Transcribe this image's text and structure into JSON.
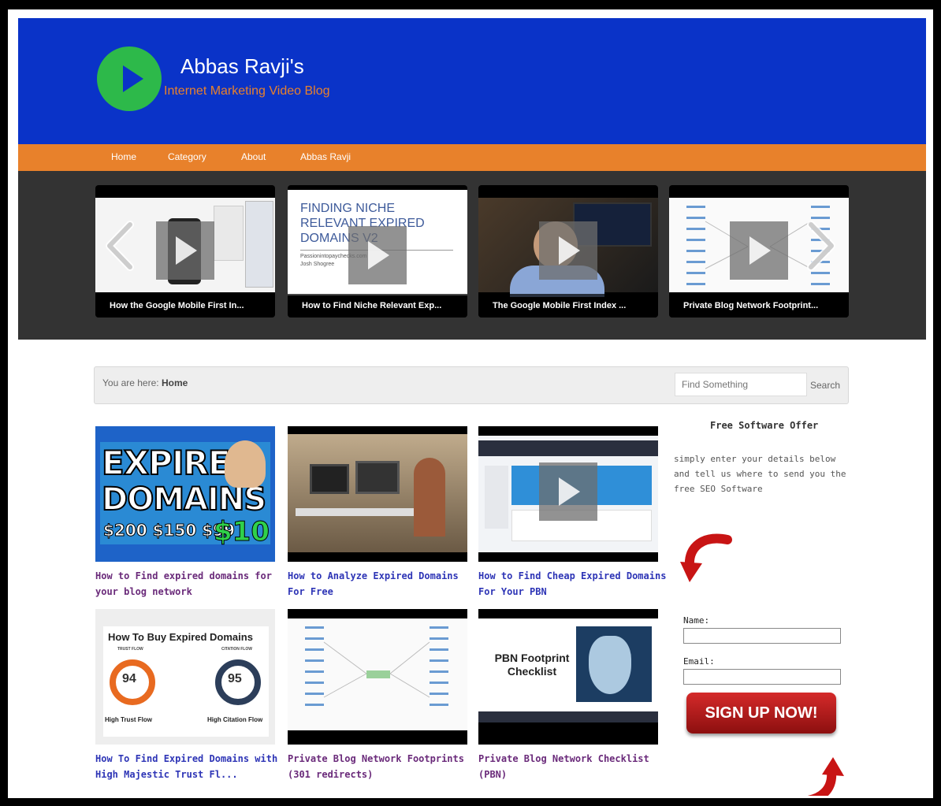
{
  "site": {
    "title": "Abbas Ravji's",
    "tagline": "Internet Marketing Video Blog"
  },
  "nav": {
    "items": [
      {
        "label": "Home"
      },
      {
        "label": "Category"
      },
      {
        "label": "About"
      },
      {
        "label": "Abbas Ravji"
      }
    ]
  },
  "slider": {
    "slides": [
      {
        "caption": "How the Google Mobile First In..."
      },
      {
        "caption": "How to Find Niche Relevant Exp...",
        "slide_text": [
          "FINDING NICHE",
          "RELEVANT EXPIRED",
          "DOMAINS V2"
        ],
        "sub_text": [
          "Passionintopaychecks.com",
          "Josh Shogree"
        ]
      },
      {
        "caption": "The Google Mobile First Index ..."
      },
      {
        "caption": "Private Blog Network Footprint..."
      }
    ]
  },
  "breadcrumb": {
    "prefix": "You are here:",
    "current": "Home"
  },
  "search": {
    "placeholder": "Find Something",
    "button": "Search"
  },
  "posts": [
    {
      "title": "How to Find expired domains for your blog network",
      "thumb_text": [
        "EXPIRED",
        "DOMAINS",
        "$200 $150 $99",
        "$10"
      ]
    },
    {
      "title": "How to Analyze Expired Domains For Free"
    },
    {
      "title": "How to Find Cheap Expired Domains For Your PBN"
    },
    {
      "title": "How To Find Expired Domains with High Majestic Trust Fl...",
      "thumb_text": [
        "How To Buy Expired Domains",
        "TRUST FLOW",
        "CITATION FLOW",
        "94",
        "95",
        "High Trust Flow",
        "High Citation Flow"
      ]
    },
    {
      "title": "Private Blog Network Footprints (301 redirects)"
    },
    {
      "title": "Private Blog Network Checklist (PBN)",
      "thumb_text": [
        "PBN Footprint",
        "Checklist"
      ]
    }
  ],
  "sidebar": {
    "heading": "Free Software Offer",
    "text": "simply enter your details below and tell us where to send you the free SEO Software",
    "name_label": "Name:",
    "email_label": "Email:",
    "signup_label": "SIGN UP NOW!"
  },
  "colors": {
    "header_bg": "#0a33c8",
    "nav_bg": "#e8812b",
    "logo_green": "#2db94a",
    "link": "#2e35b6",
    "visited_link": "#6a2a7a",
    "signup_red": "#b41c1c"
  }
}
